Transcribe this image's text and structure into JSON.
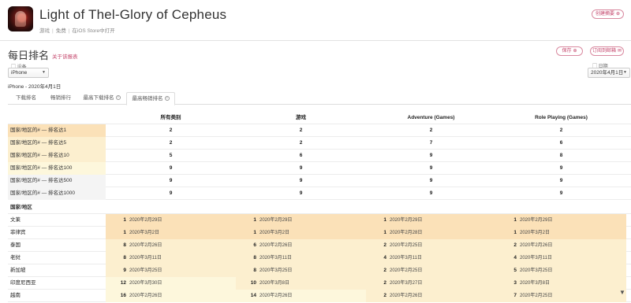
{
  "app": {
    "title": "Light of Thel-Glory of Cepheus",
    "meta": [
      "游戏",
      "免费",
      "在iOS Store中打开"
    ],
    "create_report": "创建摘要",
    "create_report_icon": "plus-icon"
  },
  "ranking": {
    "title": "每日排名",
    "about_link": "关于该报表",
    "save": "保存",
    "subscribe": "订阅到邮箱",
    "device_label": "设备",
    "device_value": "iPhone",
    "date_label": "日期",
    "date_value": "2020年4月1日",
    "subtitle": "iPhone - 2020年4月1日"
  },
  "tabs": [
    {
      "label": "下载排名",
      "help": false
    },
    {
      "label": "畅销排行",
      "help": false
    },
    {
      "label": "最高下载排名",
      "help": true
    },
    {
      "label": "最高畅销排名",
      "help": true,
      "active": true
    }
  ],
  "table": {
    "columns": [
      "所有类别",
      "游戏",
      "Adventure (Games)",
      "Role Playing (Games)"
    ],
    "summary_rows": [
      {
        "label": "国家/地区的# — 排名达1",
        "values": [
          "2",
          "2",
          "2",
          "2"
        ]
      },
      {
        "label": "国家/地区的# — 排名达5",
        "values": [
          "2",
          "2",
          "7",
          "6"
        ]
      },
      {
        "label": "国家/地区的# — 排名达10",
        "values": [
          "5",
          "6",
          "9",
          "8"
        ]
      },
      {
        "label": "国家/地区的# — 排名达100",
        "values": [
          "9",
          "9",
          "9",
          "9"
        ]
      },
      {
        "label": "国家/地区的# — 排名达500",
        "values": [
          "9",
          "9",
          "9",
          "9"
        ]
      },
      {
        "label": "国家/地区的# — 排名达1000",
        "values": [
          "9",
          "9",
          "9",
          "9"
        ]
      }
    ],
    "country_header": "国家/地区",
    "country_rows": [
      {
        "country": "文莱",
        "cells": [
          [
            "1",
            "2020年2月29日"
          ],
          [
            "1",
            "2020年2月29日"
          ],
          [
            "1",
            "2020年2月29日"
          ],
          [
            "1",
            "2020年2月29日"
          ]
        ]
      },
      {
        "country": "菲律宾",
        "cells": [
          [
            "1",
            "2020年3月2日"
          ],
          [
            "1",
            "2020年3月2日"
          ],
          [
            "1",
            "2020年2月28日"
          ],
          [
            "1",
            "2020年3月2日"
          ]
        ]
      },
      {
        "country": "泰国",
        "cells": [
          [
            "8",
            "2020年2月26日"
          ],
          [
            "6",
            "2020年2月26日"
          ],
          [
            "2",
            "2020年2月25日"
          ],
          [
            "2",
            "2020年2月26日"
          ]
        ]
      },
      {
        "country": "老挝",
        "cells": [
          [
            "8",
            "2020年3月11日"
          ],
          [
            "8",
            "2020年3月11日"
          ],
          [
            "4",
            "2020年3月11日"
          ],
          [
            "4",
            "2020年3月11日"
          ]
        ]
      },
      {
        "country": "新加坡",
        "cells": [
          [
            "9",
            "2020年3月25日"
          ],
          [
            "8",
            "2020年3月25日"
          ],
          [
            "2",
            "2020年2月25日"
          ],
          [
            "5",
            "2020年3月25日"
          ]
        ]
      },
      {
        "country": "印度尼西亚",
        "cells": [
          [
            "12",
            "2020年3月30日"
          ],
          [
            "10",
            "2020年3月8日"
          ],
          [
            "2",
            "2020年3月27日"
          ],
          [
            "3",
            "2020年3月8日"
          ]
        ]
      },
      {
        "country": "越南",
        "cells": [
          [
            "16",
            "2020年2月26日"
          ],
          [
            "14",
            "2020年2月26日"
          ],
          [
            "2",
            "2020年2月26日"
          ],
          [
            "7",
            "2020年2月25日"
          ]
        ]
      }
    ]
  },
  "colors": {
    "accent": "#c4456b",
    "rank_strong": "#fbe1b8",
    "rank_mid": "#fcefcf",
    "rank_light": "#fdf7dc",
    "rank_none": "#f4f4f4"
  }
}
